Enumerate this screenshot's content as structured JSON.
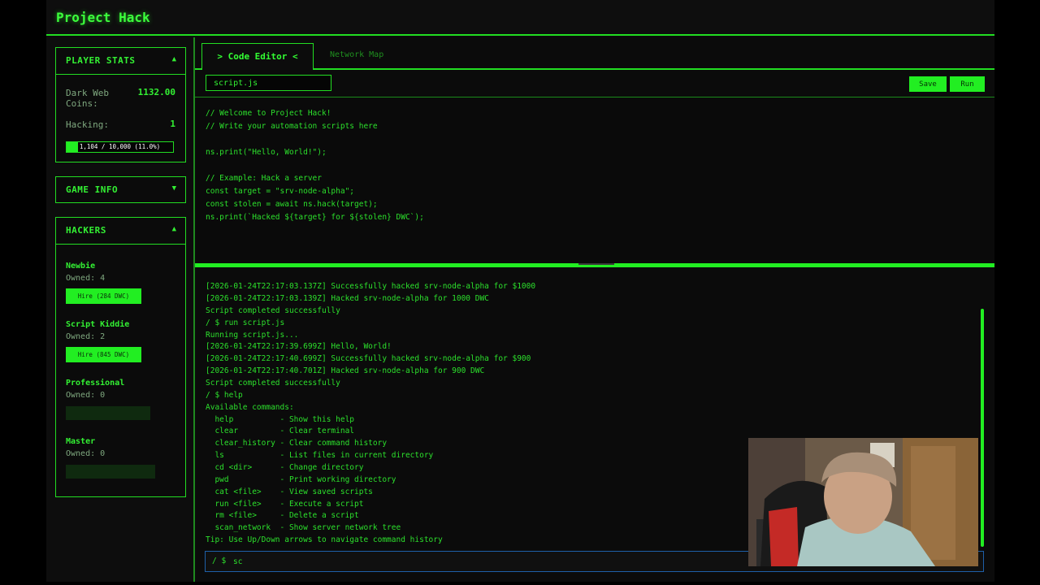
{
  "app": {
    "title": "Project Hack"
  },
  "sidebar": {
    "player_stats": {
      "title": "PLAYER STATS",
      "toggle": "▲",
      "coins_label": "Dark Web Coins:",
      "coins_value": "1132.00",
      "hacking_label": "Hacking:",
      "hacking_value": "1",
      "xp_text": "1,104 / 10,000 (11.0%)",
      "xp_fraction": 0.11
    },
    "game_info": {
      "title": "GAME INFO",
      "toggle": "▼"
    },
    "hackers": {
      "title": "HACKERS",
      "toggle": "▲",
      "items": [
        {
          "name": "Newbie",
          "owned": "Owned: 4",
          "hire": "Hire (284 DWC)"
        },
        {
          "name": "Script Kiddie",
          "owned": "Owned: 2",
          "hire": "Hire (845 DWC)"
        },
        {
          "name": "Professional",
          "owned": "Owned: 0"
        },
        {
          "name": "Master",
          "owned": "Owned: 0"
        }
      ]
    }
  },
  "tabs": {
    "active": "> Code Editor <",
    "inactive": "Network Map"
  },
  "toolbar": {
    "filename": "script.js",
    "save": "Save",
    "run": "Run"
  },
  "editor": {
    "lines": [
      "// Welcome to Project Hack!",
      "// Write your automation scripts here",
      "",
      "ns.print(\"Hello, World!\");",
      "",
      "// Example: Hack a server",
      "const target = \"srv-node-alpha\";",
      "const stolen = await ns.hack(target);",
      "ns.print(`Hacked ${target} for ${stolen} DWC`);"
    ]
  },
  "terminal": {
    "lines": [
      "[2026-01-24T22:17:03.137Z] Successfully hacked srv-node-alpha for $1000",
      "[2026-01-24T22:17:03.139Z] Hacked srv-node-alpha for 1000 DWC",
      "Script completed successfully",
      "/ $ run script.js",
      "Running script.js...",
      "[2026-01-24T22:17:39.699Z] Hello, World!",
      "[2026-01-24T22:17:40.699Z] Successfully hacked srv-node-alpha for $900",
      "[2026-01-24T22:17:40.701Z] Hacked srv-node-alpha for 900 DWC",
      "Script completed successfully",
      "/ $ help",
      "Available commands:",
      "  help          - Show this help",
      "  clear         - Clear terminal",
      "  clear_history - Clear command history",
      "  ls            - List files in current directory",
      "  cd <dir>      - Change directory",
      "  pwd           - Print working directory",
      "  cat <file>    - View saved scripts",
      "  run <file>    - Execute a script",
      "  rm <file>     - Delete a script",
      "  scan_network  - Show server network tree",
      "Tip: Use Up/Down arrows to navigate command history"
    ],
    "prompt": "/ $",
    "input_value": "sc"
  },
  "icons": {
    "heart": "heart-icon",
    "grammarly": "grammarly-icon"
  },
  "colors": {
    "accent": "#22ee22",
    "background": "#0b0b0b",
    "input_border": "#1e5fa8"
  }
}
